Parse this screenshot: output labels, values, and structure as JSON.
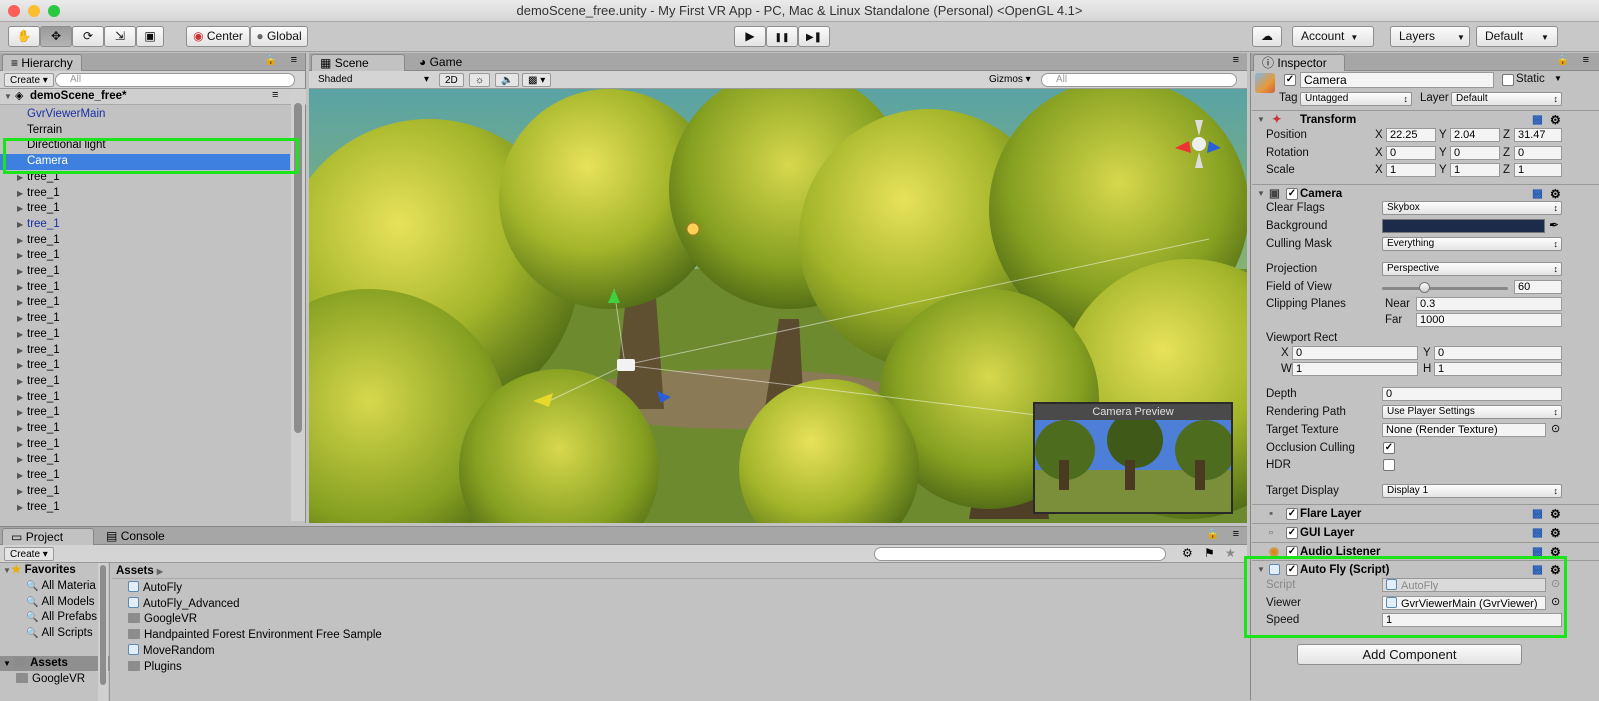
{
  "window": {
    "title": "demoScene_free.unity - My First VR App - PC, Mac & Linux Standalone (Personal) <OpenGL 4.1>"
  },
  "toolbar": {
    "tools": [
      "hand-icon",
      "move-icon",
      "rotate-icon",
      "scale-icon",
      "rect-icon"
    ],
    "pivot": "Center",
    "space": "Global",
    "play": "▶",
    "pause": "❚❚",
    "step": "▶❚",
    "account": "Account",
    "layers": "Layers",
    "layout": "Default"
  },
  "hierarchy": {
    "tab": "Hierarchy",
    "create": "Create",
    "search_placeholder": "All",
    "scene": "demoScene_free*",
    "items": [
      "GvrViewerMain",
      "Terrain",
      "Directional light",
      "Camera",
      "tree_1",
      "tree_1",
      "tree_1",
      "tree_1",
      "tree_1",
      "tree_1",
      "tree_1",
      "tree_1",
      "tree_1",
      "tree_1",
      "tree_1",
      "tree_1",
      "tree_1",
      "tree_1",
      "tree_1",
      "tree_1",
      "tree_1",
      "tree_1",
      "tree_1",
      "tree_1",
      "tree_1",
      "tree_1"
    ],
    "selected": "Camera"
  },
  "scene": {
    "tab_scene": "Scene",
    "tab_game": "Game",
    "shading": "Shaded",
    "mode_2d": "2D",
    "gizmos": "Gizmos",
    "search_placeholder": "All",
    "camera_preview": "Camera Preview"
  },
  "project": {
    "tab_project": "Project",
    "tab_console": "Console",
    "create": "Create",
    "favorites": "Favorites",
    "fav_items": [
      "All Materia",
      "All Models",
      "All Prefabs",
      "All Scripts"
    ],
    "assets_root": "Assets",
    "assets_child": "GoogleVR",
    "breadcrumb": "Assets",
    "files": [
      {
        "name": "AutoFly",
        "kind": "script"
      },
      {
        "name": "AutoFly_Advanced",
        "kind": "script"
      },
      {
        "name": "GoogleVR",
        "kind": "folder"
      },
      {
        "name": "Handpainted Forest Environment Free Sample",
        "kind": "folder"
      },
      {
        "name": "MoveRandom",
        "kind": "script"
      },
      {
        "name": "Plugins",
        "kind": "folder"
      }
    ]
  },
  "inspector": {
    "tab": "Inspector",
    "object_name": "Camera",
    "static": "Static",
    "tag_label": "Tag",
    "tag": "Untagged",
    "layer_label": "Layer",
    "layer": "Default",
    "transform": {
      "title": "Transform",
      "position": {
        "label": "Position",
        "x": "22.25",
        "y": "2.04",
        "z": "31.47"
      },
      "rotation": {
        "label": "Rotation",
        "x": "0",
        "y": "0",
        "z": "0"
      },
      "scale": {
        "label": "Scale",
        "x": "1",
        "y": "1",
        "z": "1"
      }
    },
    "camera": {
      "title": "Camera",
      "clear_flags_label": "Clear Flags",
      "clear_flags": "Skybox",
      "background_label": "Background",
      "background_color": "#1c2b4a",
      "culling_mask_label": "Culling Mask",
      "culling_mask": "Everything",
      "projection_label": "Projection",
      "projection": "Perspective",
      "fov_label": "Field of View",
      "fov": "60",
      "clipping_label": "Clipping Planes",
      "near_label": "Near",
      "near": "0.3",
      "far_label": "Far",
      "far": "1000",
      "viewport_label": "Viewport Rect",
      "vx": "0",
      "vy": "0",
      "vw": "1",
      "vh": "1",
      "depth_label": "Depth",
      "depth": "0",
      "rendering_path_label": "Rendering Path",
      "rendering_path": "Use Player Settings",
      "target_texture_label": "Target Texture",
      "target_texture": "None (Render Texture)",
      "occlusion_label": "Occlusion Culling",
      "hdr_label": "HDR",
      "target_display_label": "Target Display",
      "target_display": "Display 1"
    },
    "flare_layer": "Flare Layer",
    "gui_layer": "GUI Layer",
    "audio_listener": "Audio Listener",
    "autofly": {
      "title": "Auto Fly (Script)",
      "script_label": "Script",
      "script": "AutoFly",
      "viewer_label": "Viewer",
      "viewer": "GvrViewerMain (GvrViewer)",
      "speed_label": "Speed",
      "speed": "1"
    },
    "add_component": "Add Component"
  },
  "labels": {
    "X": "X",
    "Y": "Y",
    "Z": "Z",
    "W": "W",
    "H": "H"
  },
  "colors": {
    "selection": "#3d80df",
    "highlight": "#19e519"
  }
}
